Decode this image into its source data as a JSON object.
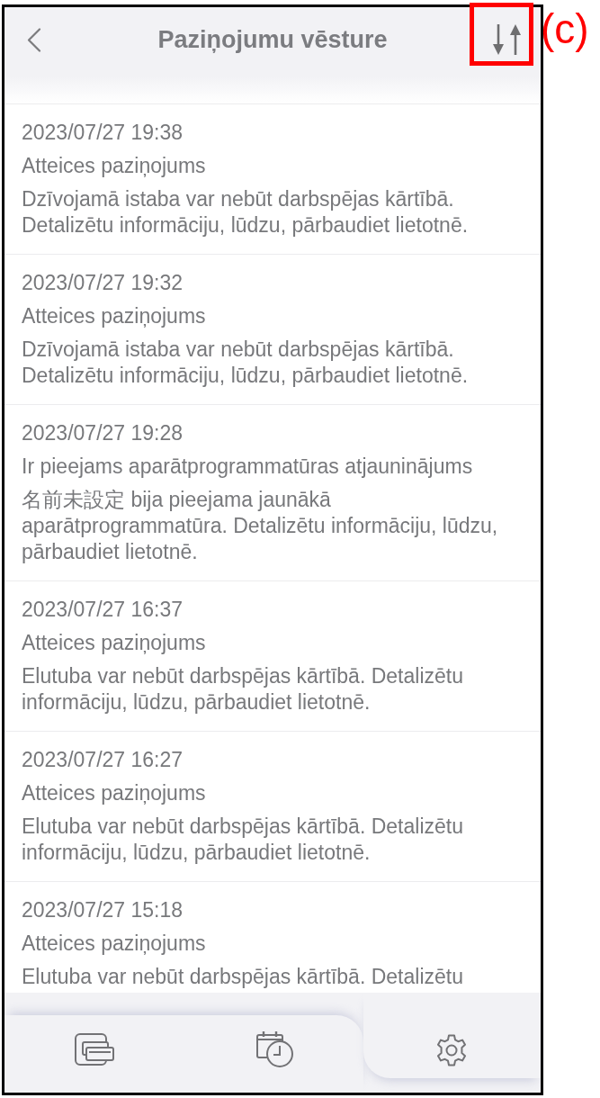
{
  "header": {
    "title": "Paziņojumu vēsture"
  },
  "annotation": {
    "label": "(c)"
  },
  "notifications": [
    {
      "time": "2023/07/27 19:38",
      "title": "Atteices paziņojums",
      "message": "Dzīvojamā istaba var nebūt darbspējas kārtībā. Detalizētu informāciju, lūdzu, pārbaudiet lietotnē."
    },
    {
      "time": "2023/07/27 19:32",
      "title": "Atteices paziņojums",
      "message": "Dzīvojamā istaba var nebūt darbspējas kārtībā. Detalizētu informāciju, lūdzu, pārbaudiet lietotnē."
    },
    {
      "time": "2023/07/27 19:28",
      "title": "Ir pieejams aparātprogrammatūras atjauninājums",
      "message": "名前未設定 bija pieejama jaunākā aparātprogrammatūra. Detalizētu informāciju, lūdzu, pārbaudiet lietotnē."
    },
    {
      "time": "2023/07/27 16:37",
      "title": "Atteices paziņojums",
      "message": "Elutuba var nebūt darbspējas kārtībā. Detalizētu informāciju, lūdzu, pārbaudiet lietotnē."
    },
    {
      "time": "2023/07/27 16:27",
      "title": "Atteices paziņojums",
      "message": "Elutuba var nebūt darbspējas kārtībā. Detalizētu informāciju, lūdzu, pārbaudiet lietotnē."
    },
    {
      "time": "2023/07/27 15:18",
      "title": "Atteices paziņojums",
      "message": "Elutuba var nebūt darbspējas kārtībā. Detalizētu"
    }
  ]
}
